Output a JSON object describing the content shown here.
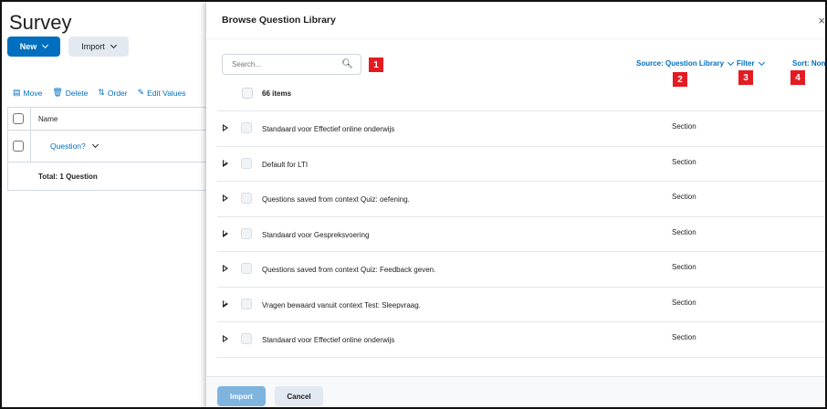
{
  "background_page": {
    "title": "Survey",
    "new_button": "New",
    "import_button": "Import",
    "toolbar": {
      "move": "Move",
      "delete": "Delete",
      "order": "Order",
      "edit_values": "Edit Values"
    },
    "table": {
      "header_name": "Name",
      "question_link": "Question?",
      "total": "Total:  1 Question"
    }
  },
  "dialog": {
    "title": "Browse Question Library",
    "close": "×",
    "search_placeholder": "Search...",
    "source_dropdown": "Source: Question Library",
    "filter_dropdown": "Filter",
    "sort_dropdown": "Sort: None",
    "items_count": "66 items",
    "markers": [
      "1",
      "2",
      "3",
      "4"
    ],
    "rows": [
      {
        "title": "Standaard voor Effectief online onderwijs",
        "type": "Section"
      },
      {
        "title": "Default for LTI",
        "type": "Section"
      },
      {
        "title": "Questions saved from context Quiz: oefening.",
        "type": "Section"
      },
      {
        "title": "Standaard voor Gespreksvoering",
        "type": "Section"
      },
      {
        "title": "Questions saved from context Quiz: Feedback geven.",
        "type": "Section"
      },
      {
        "title": "Vragen bewaard vanuit context Test: Sleepvraag.",
        "type": "Section"
      },
      {
        "title": "Standaard voor Effectief online onderwijs",
        "type": "Section"
      }
    ],
    "footer": {
      "import_button": "Import",
      "cancel_button": "Cancel"
    }
  },
  "colors": {
    "primary": "#006fbf",
    "primary_disabled": "#7fb4df",
    "marker_red": "#e31b23",
    "secondary_button": "#e3e9f1"
  }
}
